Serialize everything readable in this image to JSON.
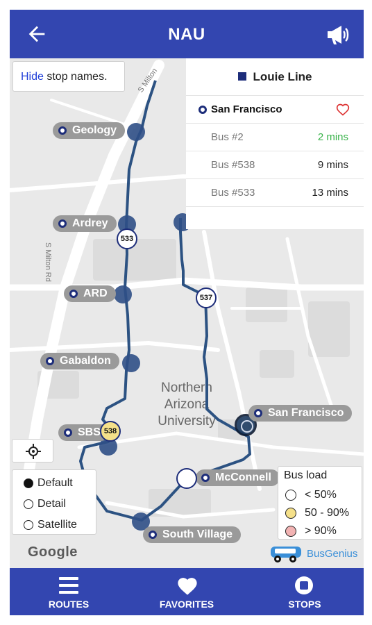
{
  "app_bar": {
    "title": "NAU",
    "back_icon": "arrow-left-icon",
    "announce_icon": "megaphone-icon",
    "color": "#3346b0"
  },
  "map": {
    "hide_toggle": {
      "action": "Hide",
      "rest": "stop names."
    },
    "street_labels": [
      "S Milton",
      "S Milton Rd"
    ],
    "campus_label": [
      "Northern",
      "Arizona",
      "University"
    ],
    "stops": [
      "Geology",
      "Ardrey",
      "ARD",
      "Gabaldon",
      "SBS",
      "San Francisco",
      "McConnell",
      "South Village"
    ],
    "buses": [
      {
        "number": "533",
        "load": "< 50%"
      },
      {
        "number": "537",
        "load": "< 50%"
      },
      {
        "number": "538",
        "load": "50 - 90%"
      }
    ],
    "route_color": "#2c5282",
    "google_logo": "Google",
    "busgenius_logo": "BusGenius"
  },
  "info_panel": {
    "line_name": "Louie Line",
    "line_color": "#1d2d7a",
    "selected_stop": "San Francisco",
    "arrivals": [
      {
        "bus": "Bus #2",
        "eta": "2 mins",
        "eta_color": "#39b34a"
      },
      {
        "bus": "Bus #538",
        "eta": "9 mins"
      },
      {
        "bus": "Bus #533",
        "eta": "13 mins"
      }
    ]
  },
  "map_type": {
    "options": [
      "Default",
      "Detail",
      "Satellite"
    ],
    "selected": "Default"
  },
  "legend": {
    "title": "Bus load",
    "items": [
      {
        "label": "< 50%",
        "color": "#ffffff"
      },
      {
        "label": "50 - 90%",
        "color": "#f5e08a"
      },
      {
        "label": "> 90%",
        "color": "#f2b3b3"
      }
    ]
  },
  "tab_bar": {
    "tabs": [
      {
        "label": "ROUTES",
        "icon": "list-icon"
      },
      {
        "label": "FAVORITES",
        "icon": "heart-icon"
      },
      {
        "label": "STOPS",
        "icon": "stop-icon"
      }
    ]
  }
}
